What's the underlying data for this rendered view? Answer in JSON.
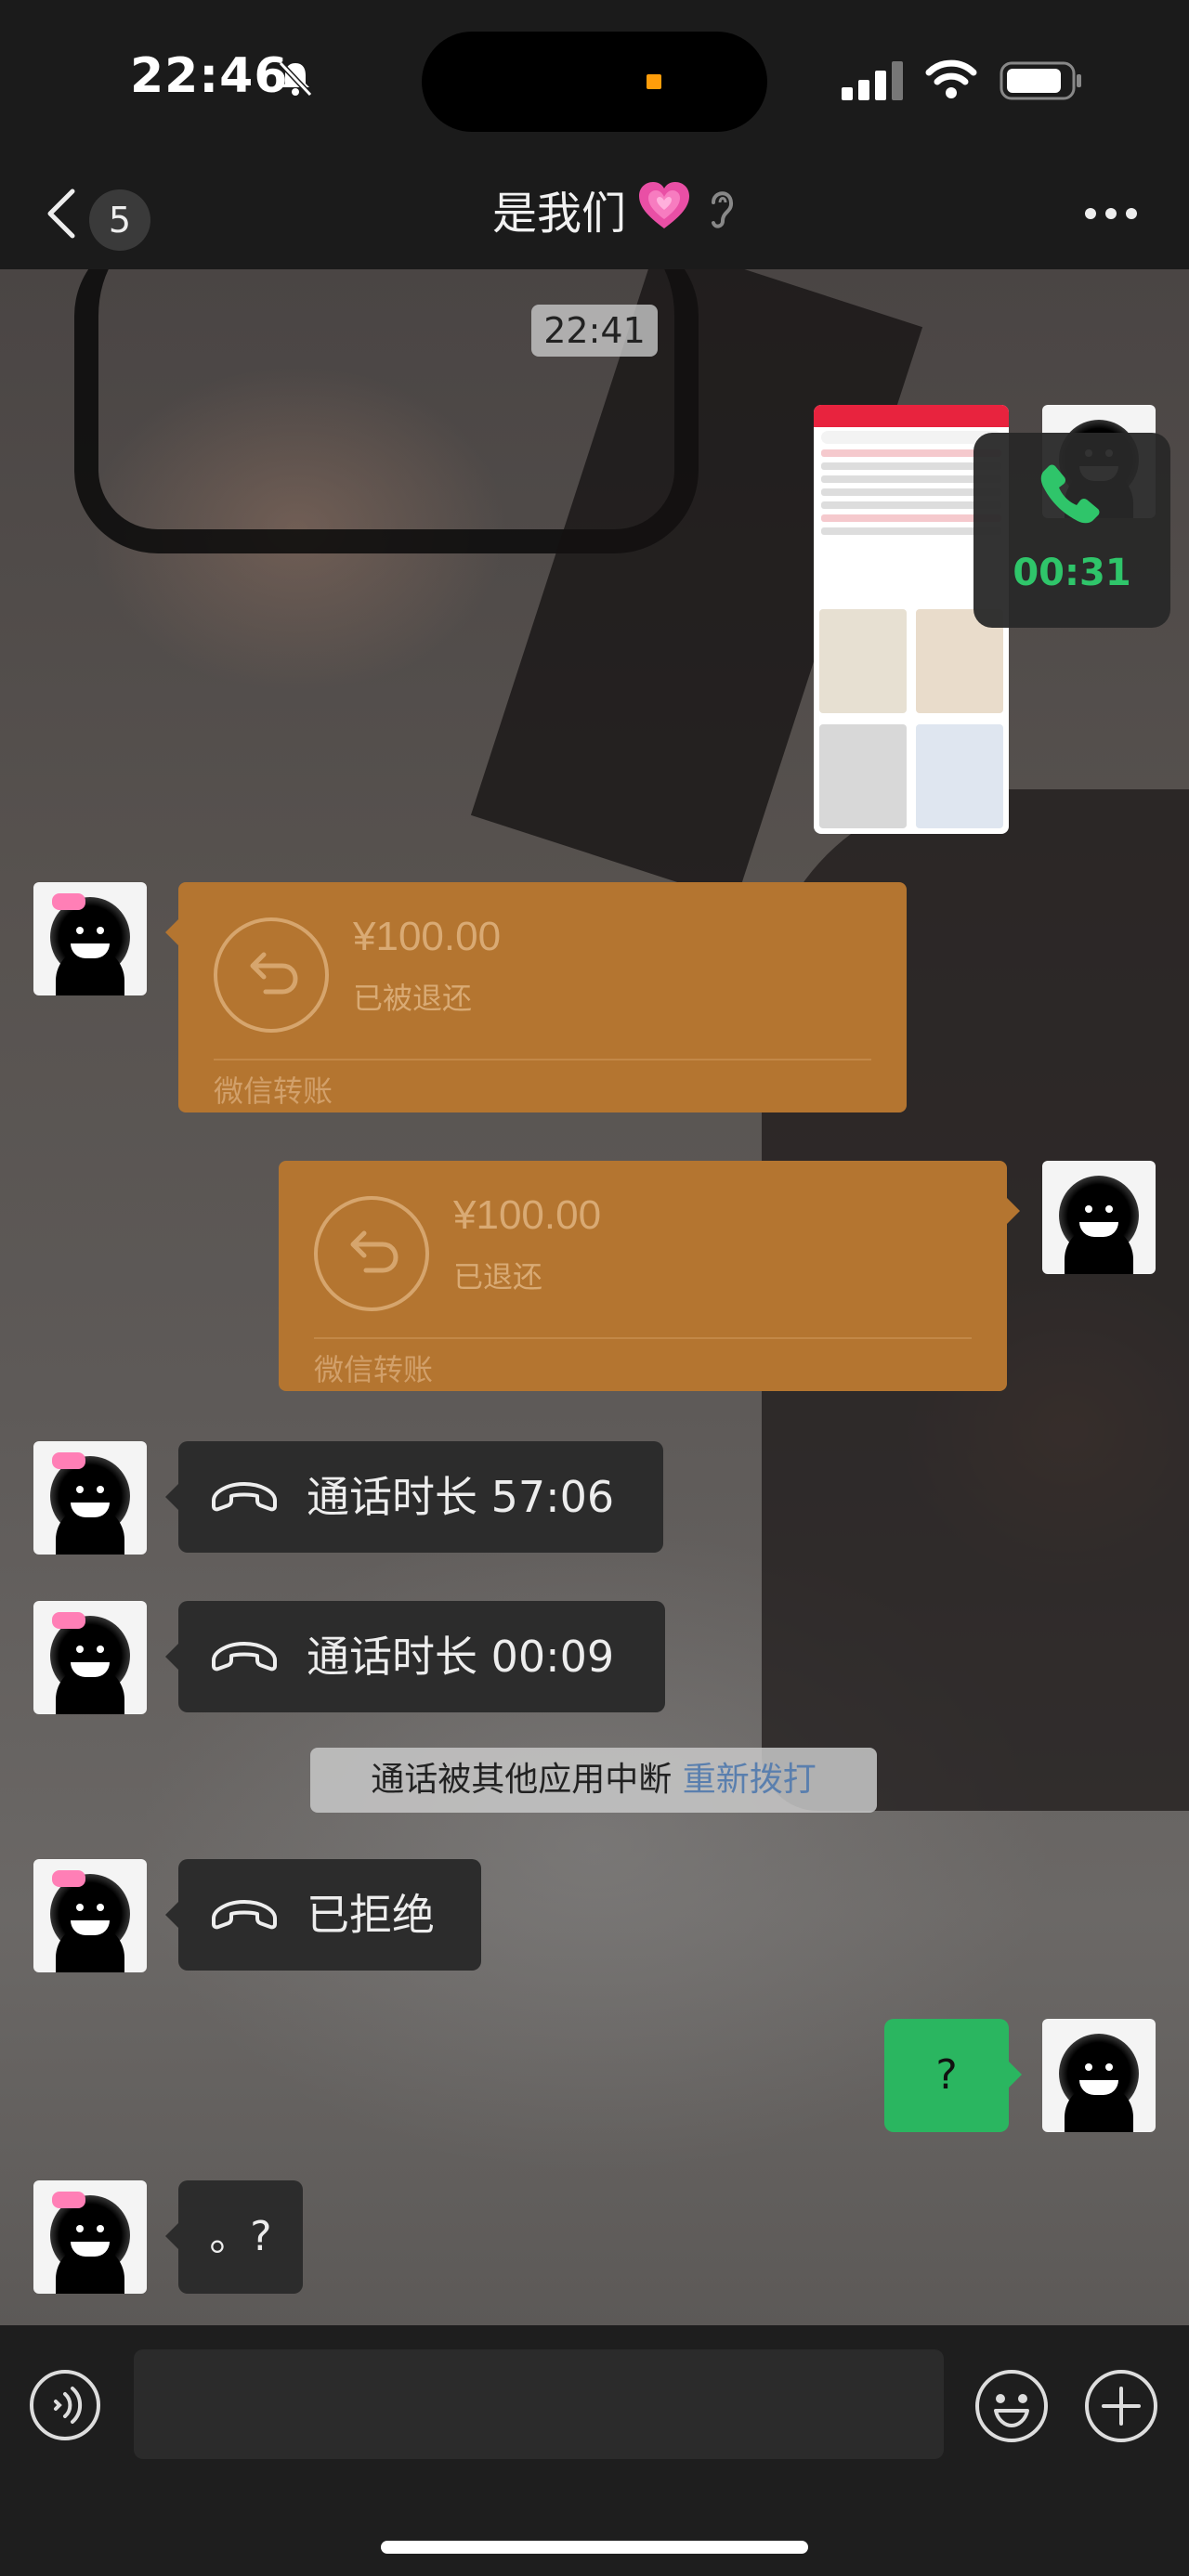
{
  "status_bar": {
    "time": "22:46",
    "icons": [
      "bell-muted-icon",
      "signal-icon",
      "wifi-icon",
      "battery-icon"
    ]
  },
  "nav": {
    "back_count": "5",
    "title": "是我们",
    "title_emoji": "heart-icon",
    "ear_icon": "ear-icon",
    "more_icon": "more-icon"
  },
  "chat": {
    "timestamp": "22:41",
    "call_float": {
      "duration": "00:31"
    },
    "transfer_received": {
      "amount": "¥100.00",
      "status": "已被退还",
      "footer": "微信转账"
    },
    "transfer_sent": {
      "amount": "¥100.00",
      "status": "已退还",
      "footer": "微信转账"
    },
    "call_records": [
      {
        "text": "通话时长 57:06"
      },
      {
        "text": "通话时长 00:09"
      },
      {
        "text": "已拒绝"
      }
    ],
    "system_notice": {
      "text": "通话被其他应用中断",
      "link": "重新拨打"
    },
    "sent_text": "?",
    "received_text": "。?"
  },
  "colors": {
    "transfer_bg": "#b47530",
    "green_bubble": "#2ab660",
    "call_green": "#2fc56a",
    "link_blue": "#5a7fae"
  }
}
